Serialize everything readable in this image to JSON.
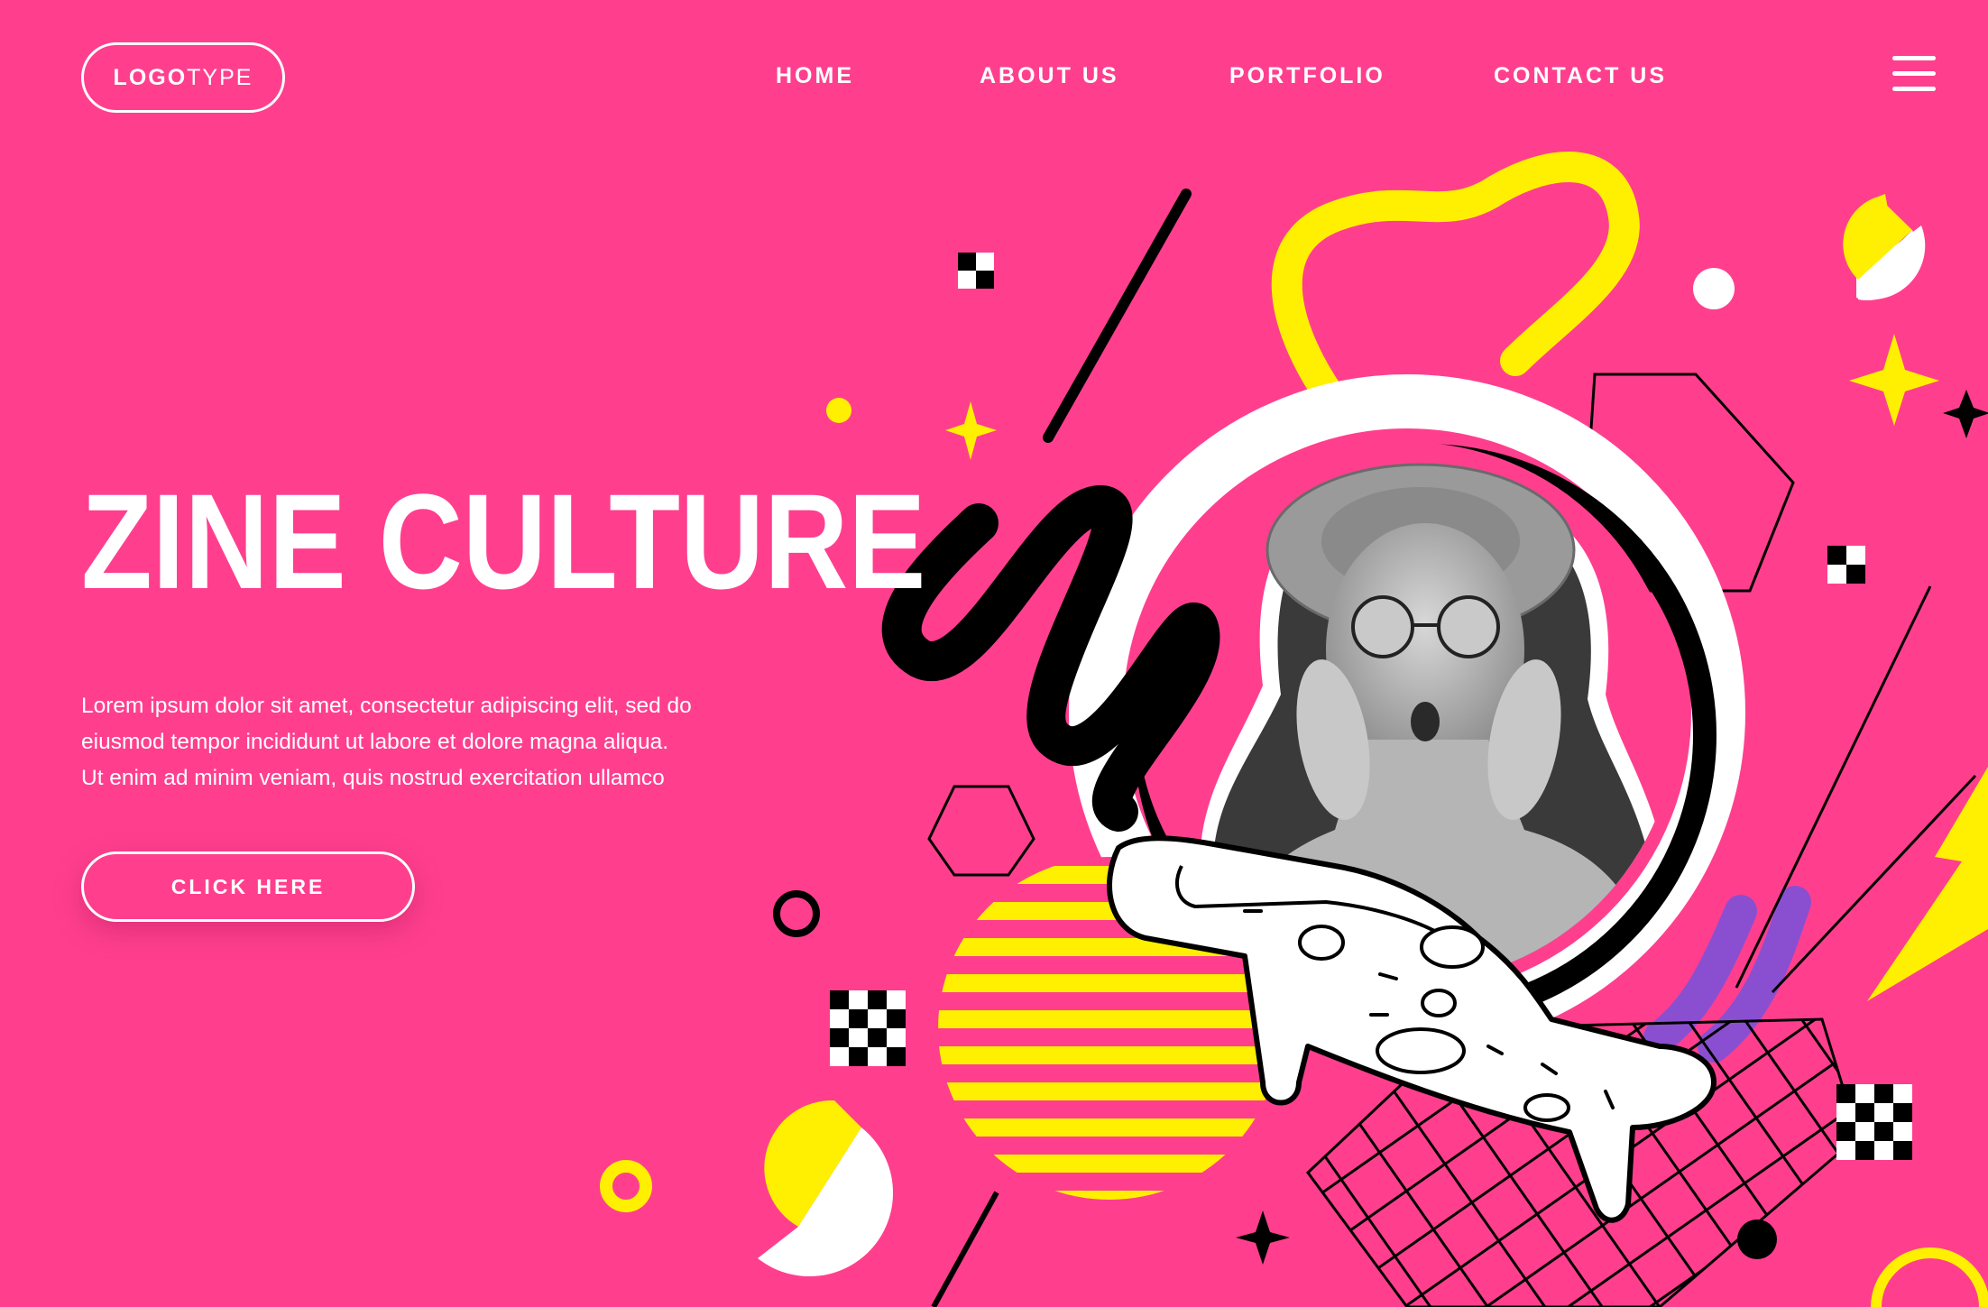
{
  "header": {
    "logo_bold": "LOGO",
    "logo_light": "TYPE",
    "nav": [
      {
        "label": "HOME"
      },
      {
        "label": "ABOUT US"
      },
      {
        "label": "PORTFOLIO"
      },
      {
        "label": "CONTACT US"
      }
    ],
    "menu_icon": "hamburger-menu-icon"
  },
  "hero": {
    "title": "ZINE CULTURE",
    "body_lines": [
      "Lorem ipsum dolor sit amet, consectetur adipiscing elit, sed do",
      "eiusmod tempor incididunt ut labore et dolore magna aliqua.",
      "Ut enim ad minim veniam, quis nostrud exercitation ullamco"
    ],
    "cta_label": "CLICK HERE"
  },
  "colors": {
    "background": "#ff3f8e",
    "accent_yellow": "#ffef00",
    "accent_purple": "#8a4fd0",
    "ink": "#000000",
    "paper": "#ffffff"
  },
  "illustration": {
    "subject": "woman-with-hat-and-sunglasses-photo",
    "props": [
      "pizza-slice-icon",
      "sparkle-icon",
      "checker-icon",
      "lightning-icon",
      "hexagon-icon"
    ]
  }
}
